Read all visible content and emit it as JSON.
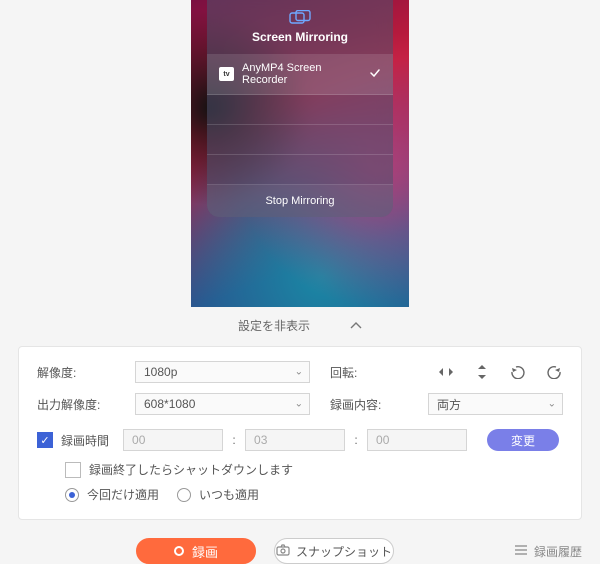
{
  "phone": {
    "mirror_title": "Screen Mirroring",
    "device_name": "AnyMP4 Screen Recorder",
    "stop_label": "Stop Mirroring"
  },
  "collapse": {
    "label": "設定を非表示"
  },
  "settings": {
    "resolution_label": "解像度:",
    "resolution_value": "1080p",
    "output_res_label": "出力解像度:",
    "output_res_value": "608*1080",
    "rotation_label": "回転:",
    "content_label": "録画内容:",
    "content_value": "両方",
    "rec_time_label": "録画時間",
    "time_h": "00",
    "time_m": "03",
    "time_s": "00",
    "change_btn": "変更",
    "shutdown_label": "録画終了したらシャットダウンします",
    "apply_once_label": "今回だけ適用",
    "apply_always_label": "いつも適用"
  },
  "bottom": {
    "record": "録画",
    "snapshot": "スナップショット",
    "history": "録画履歴"
  }
}
